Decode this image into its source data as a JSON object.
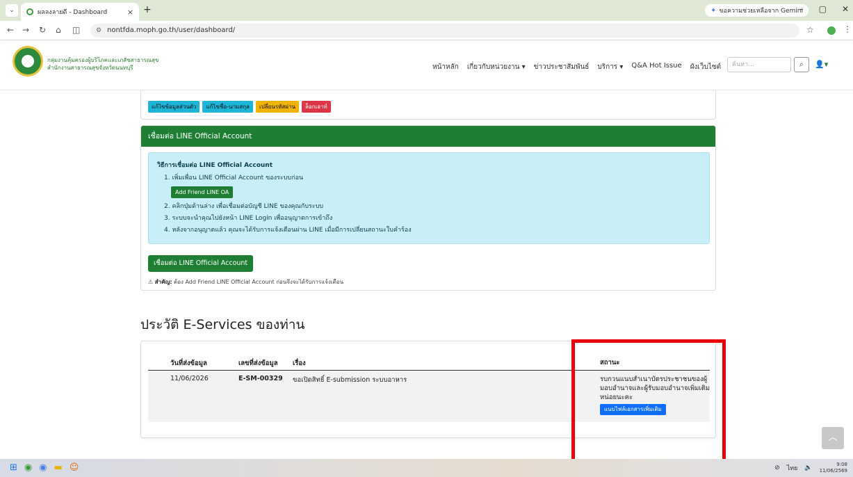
{
  "browser": {
    "tab_title": "ผลลงลายดี - Dashboard",
    "url": "nontfda.moph.go.th/user/dashboard/",
    "gemini_label": "ขอความช่วยเหลือจาก Gemini"
  },
  "header": {
    "org_line1": "กลุ่มงานคุ้มครองผู้บริโภคและเภสัชสาธารณสุข",
    "org_line2": "สำนักงานสาธารณสุขจังหวัดนนทบุรี",
    "nav": [
      "หน้าหลัก",
      "เกี่ยวกับหน่วยงาน ▾",
      "ข่าวประชาสัมพันธ์",
      "บริการ ▾",
      "Q&A Hot Issue",
      "ผังเว็บไซต์"
    ],
    "search_placeholder": "ค้นหา..."
  },
  "profile_buttons": {
    "edit_profile": "แก้ไขข้อมูลส่วนตัว",
    "edit_name": "แก้ไขชื่อ-นามสกุล",
    "change_password": "เปลี่ยนรหัสผ่าน",
    "logout": "ล็อกเอาท์"
  },
  "line_card": {
    "header": "เชื่อมต่อ LINE Official Account",
    "how_title": "วิธีการเชื่อมต่อ LINE Official Account",
    "step1": "1. เพิ่มเพื่อน LINE Official Account ของระบบก่อน",
    "add_friend_btn": "Add Friend LINE OA",
    "step2": "2. คลิกปุ่มด้านล่าง เพื่อเชื่อมต่อบัญชี LINE ของคุณกับระบบ",
    "step3": "3. ระบบจะนำคุณไปยังหน้า LINE Login เพื่ออนุญาตการเข้าถึง",
    "step4": "4. หลังจากอนุญาตแล้ว คุณจะได้รับการแจ้งเตือนผ่าน LINE เมื่อมีการเปลี่ยนสถานะใบคำร้อง",
    "connect_btn": "เชื่อมต่อ LINE Official Account",
    "note_label": "สำคัญ:",
    "note_text": "ต้อง Add Friend LINE Official Account ก่อนจึงจะได้รับการแจ้งเตือน"
  },
  "history": {
    "title": "ประวัติ E-Services ของท่าน",
    "columns": [
      "วันที่ส่งข้อมูล",
      "เลขที่ส่งข้อมูล",
      "เรื่อง",
      "สถานะ"
    ],
    "rows": [
      {
        "date": "11/06/2026",
        "number": "E-SM-00329",
        "subject": "ขอเปิดสิทธิ์ E-submission ระบบอาหาร",
        "status": "รบกวนแนบสำเนาบัตรประชาชนของผู้มอบอำนาจและผู้รับมอบอำนาจเพิ่มเติมหน่อยนะคะ",
        "attach_btn": "แนบไฟล์เอกสารเพิ่มเติม"
      }
    ]
  },
  "taskbar": {
    "lang": "ไทย",
    "time": "9:08",
    "date": "11/06/2569"
  },
  "colors": {
    "brand_green": "#1e7e34",
    "info_bg": "#c8eef7",
    "highlight_red": "#e8000b",
    "primary_blue": "#0d6efd"
  }
}
